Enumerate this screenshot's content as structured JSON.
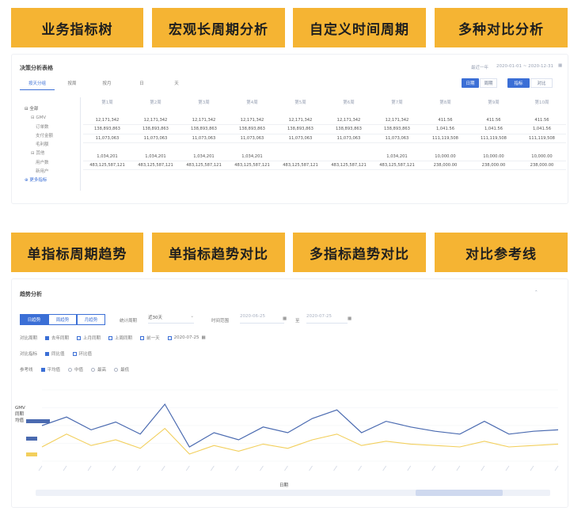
{
  "features_top": [
    "业务指标树",
    "宏观长周期分析",
    "自定义时间周期",
    "多种对比分析"
  ],
  "features_bottom": [
    "单指标周期趋势",
    "单指标趋势对比",
    "多指标趋势对比",
    "对比参考线"
  ],
  "top_panel": {
    "title": "决策分析表格",
    "top_right_texts": [
      "最近一年",
      "2020-01-01 ~ 2020-12-31"
    ],
    "buttons": [
      "日期",
      "周期",
      "指标",
      "对比"
    ],
    "tabs": [
      "按天分组",
      "按周",
      "按月",
      "日",
      "天"
    ],
    "tree": [
      "全部",
      "GMV",
      "订单数",
      "支付金额",
      "毛利额",
      "净利润",
      "客单价",
      "其他",
      "用户数",
      "新用户",
      "更多指标"
    ],
    "columns": [
      "第1周",
      "第2周",
      "第3周",
      "第4周",
      "第5周",
      "第6周",
      "第7周",
      "第8周",
      "第9周",
      "第10周"
    ],
    "rows": [
      [
        "12,171,342",
        "12,171,342",
        "12,171,342",
        "12,171,342",
        "12,171,342",
        "12,171,342",
        "12,171,342",
        "411.56",
        "411.56",
        "411.56"
      ],
      [
        "138,893,863",
        "138,893,863",
        "138,893,863",
        "138,893,863",
        "138,893,863",
        "138,893,863",
        "138,893,863",
        "1,041.56",
        "1,041.56",
        "1,041.56"
      ],
      [
        "11,073,063",
        "11,073,063",
        "11,073,063",
        "11,073,063",
        "11,073,063",
        "11,073,063",
        "11,073,063",
        "111,119,508",
        "111,119,508",
        "111,119,508"
      ],
      [
        "1,034,201",
        "1,034,201",
        "1,034,201",
        "1,034,201",
        "",
        "",
        "1,034,201",
        "10,000.00",
        "10,000.00",
        "10,000.00"
      ],
      [
        "483,125,587,121",
        "483,125,587,121",
        "483,125,587,121",
        "483,125,587,121",
        "483,125,587,121",
        "483,125,587,121",
        "483,125,587,121",
        "238,000.00",
        "238,000.00",
        "238,000.00"
      ]
    ]
  },
  "bottom_panel": {
    "title": "趋势分析",
    "segments": [
      "日趋势",
      "周趋势",
      "月趋势"
    ],
    "fields": {
      "period_label": "统计周期",
      "period_value": "近30天",
      "range_label": "时间范围",
      "range_start": "2020-06-25",
      "range_end": "2020-07-25",
      "range_sep": "至"
    },
    "row1_label": "对比周期",
    "row1_options": [
      {
        "label": "去年同期",
        "checked": true
      },
      {
        "label": "上月同期",
        "checked": false
      },
      {
        "label": "上周同期",
        "checked": false
      },
      {
        "label": "前一天",
        "checked": false
      },
      {
        "label": "2020-07-25",
        "checked": false
      }
    ],
    "row2_label": "对比指标",
    "row2_options": [
      {
        "label": "同比值",
        "checked": true
      },
      {
        "label": "环比值",
        "checked": false
      }
    ],
    "row3_label": "参考线",
    "row3_options": [
      {
        "label": "平均值",
        "checked": true
      },
      {
        "label": "中值",
        "checked": false
      },
      {
        "label": "最高",
        "checked": false
      },
      {
        "label": "最低",
        "checked": false
      }
    ],
    "legend": [
      "GMV",
      "同期",
      "均值"
    ],
    "xlabel": "日期",
    "colors": {
      "primary": "#3b6fd6",
      "line1": "#4a6ab0",
      "line2": "#f2cf5c",
      "accent": "#f5b433"
    }
  },
  "chart_data": {
    "type": "line",
    "x": [
      "1",
      "2",
      "3",
      "4",
      "5",
      "6",
      "7",
      "8",
      "9",
      "10",
      "11",
      "12",
      "13",
      "14",
      "15",
      "16",
      "17",
      "18",
      "19",
      "20",
      "21",
      "22"
    ],
    "series": [
      {
        "values": [
          50,
          62,
          44,
          55,
          38,
          80,
          20,
          40,
          30,
          48,
          40,
          60,
          72,
          40,
          56,
          48,
          42,
          38,
          56,
          38,
          42,
          44
        ]
      },
      {
        "values": [
          20,
          38,
          22,
          30,
          18,
          46,
          10,
          22,
          14,
          24,
          18,
          30,
          38,
          22,
          28,
          24,
          22,
          20,
          28,
          20,
          22,
          24
        ]
      }
    ]
  }
}
